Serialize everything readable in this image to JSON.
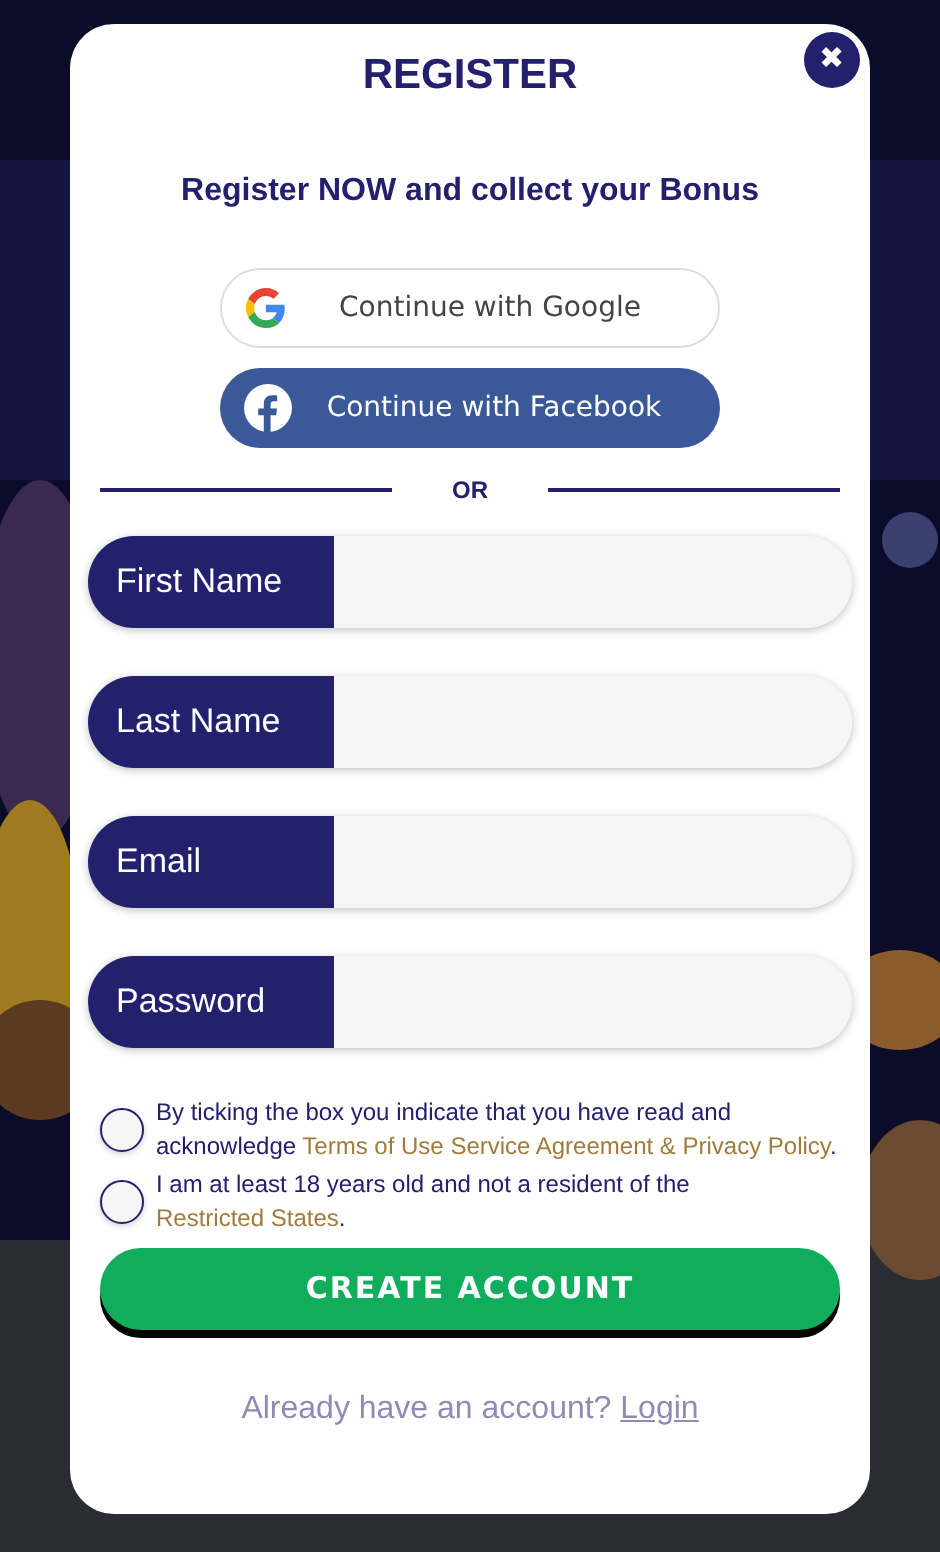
{
  "modal": {
    "close": "✖",
    "title": "REGISTER",
    "subtitle": "Register NOW and collect your Bonus",
    "social_buttons": [
      {
        "kind": "google",
        "label": "Continue with Google"
      },
      {
        "kind": "facebook",
        "label": "Continue with Facebook"
      }
    ],
    "divider": "OR",
    "fields": [
      {
        "label": "First Name"
      },
      {
        "label": "Last Name"
      },
      {
        "label": "Email"
      },
      {
        "label": "Password"
      }
    ],
    "consents": [
      {
        "checked": false,
        "parts": [
          {
            "kind": "text",
            "text": "By ticking the box you indicate that you have read and acknowledge "
          },
          {
            "kind": "link",
            "text": "Terms of Use Service Agreement & Privacy Policy"
          },
          {
            "kind": "text",
            "text": "."
          }
        ]
      },
      {
        "checked": false,
        "parts": [
          {
            "kind": "text",
            "text": "I am at least 18 years old and not a resident of the "
          },
          {
            "kind": "link",
            "text": "Restricted States"
          },
          {
            "kind": "text",
            "text": "."
          }
        ]
      }
    ],
    "submit": "CREATE ACCOUNT",
    "footer": {
      "text": "Already have an account?",
      "link": "Login"
    }
  }
}
